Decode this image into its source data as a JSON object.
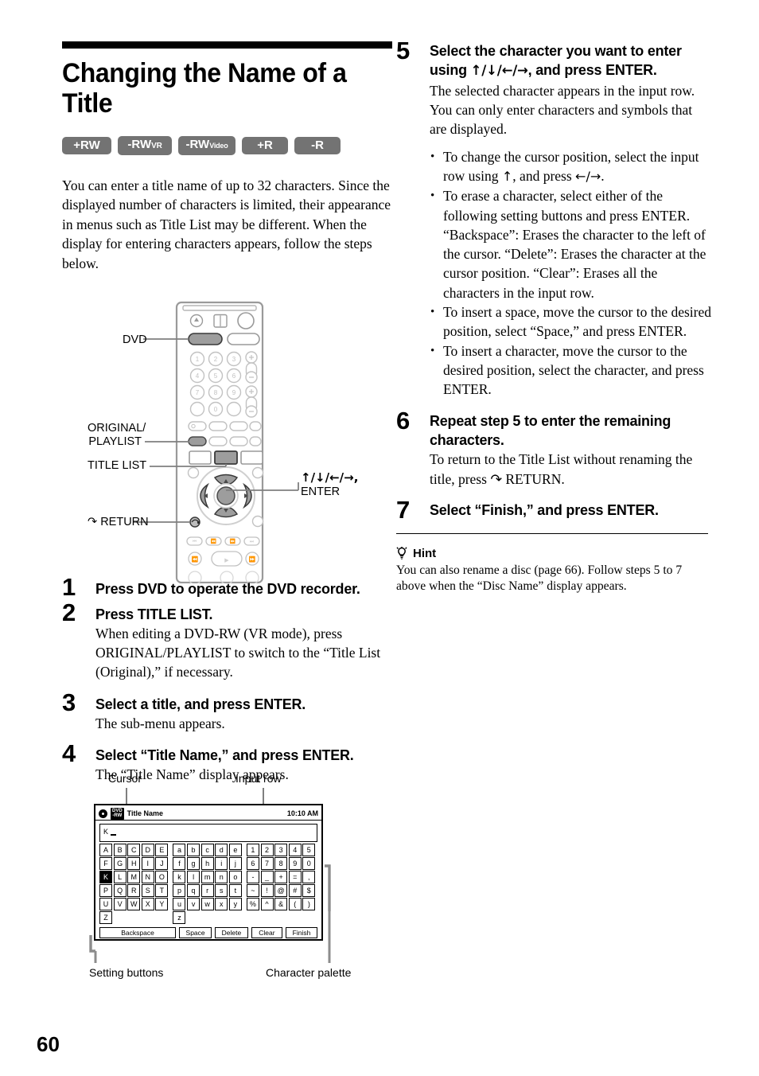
{
  "page": {
    "number": "60"
  },
  "section": {
    "title": "Changing the Name of a Title",
    "badges": [
      {
        "name": "plus-rw",
        "main": "+RW",
        "sub": ""
      },
      {
        "name": "minus-rw-vr",
        "main": "-RW",
        "sub": "VR"
      },
      {
        "name": "minus-rw-video",
        "main": "-RW",
        "sub": "Video"
      },
      {
        "name": "plus-r",
        "main": "+R",
        "sub": ""
      },
      {
        "name": "minus-r",
        "main": "-R",
        "sub": ""
      }
    ],
    "intro": "You can enter a title name of up to 32 characters. Since the displayed number of characters is limited, their appearance in menus such as Title List may be different. When the display for entering characters appears, follow the steps below."
  },
  "remote": {
    "callouts": [
      {
        "name": "dvd",
        "label": "DVD"
      },
      {
        "name": "original-playlist",
        "label": "ORIGINAL/\nPLAYLIST",
        "line1": "ORIGINAL/",
        "line2": "PLAYLIST"
      },
      {
        "name": "title-list",
        "label": "TITLE LIST"
      },
      {
        "name": "return",
        "label": "RETURN"
      },
      {
        "name": "dpad-enter",
        "line1": "↑/↓/←/→,",
        "line2": "ENTER"
      }
    ]
  },
  "steps_left": [
    {
      "num": "1",
      "head": "Press DVD to operate the DVD recorder.",
      "sub": ""
    },
    {
      "num": "2",
      "head": "Press TITLE LIST.",
      "sub": "When editing a DVD-RW (VR mode), press ORIGINAL/PLAYLIST to switch to the “Title List (Original),” if necessary."
    },
    {
      "num": "3",
      "head": "Select a title, and press ENTER.",
      "sub": "The sub-menu appears."
    },
    {
      "num": "4",
      "head": "Select “Title Name,” and press ENTER.",
      "sub": "The “Title Name” display appears."
    }
  ],
  "steps_right": [
    {
      "num": "5",
      "head_line1": "Select the character you want to enter",
      "head_line2_pre": "using ",
      "head_arrows": "↑/↓/←/→",
      "head_line2_post": ", and press ENTER.",
      "sub1": "The selected character appears in the input row.",
      "sub2": "You can only enter characters and symbols that are displayed.",
      "bullets": [
        {
          "name": "bullet-cursor-position",
          "pre": "To change the cursor position, select the input row using ",
          "arrow1": "↑",
          "mid": ", and press ",
          "arrow2": "←/→",
          "post": "."
        },
        {
          "name": "bullet-erase-character",
          "text": "To erase a character, select either of the following setting buttons and press ENTER. “Backspace”: Erases the character to the left of the cursor. “Delete”: Erases the character at the cursor position. “Clear”: Erases all the characters in the input row."
        },
        {
          "name": "bullet-insert-space",
          "text": "To insert a space, move the cursor to the desired position, select “Space,” and press ENTER."
        },
        {
          "name": "bullet-insert-character",
          "text": "To insert a character, move the cursor to the desired position, select the character, and press ENTER."
        }
      ]
    },
    {
      "num": "6",
      "head_line1": "Repeat step 5 to enter the remaining",
      "head_line2": "characters.",
      "sub_pre": "To return to the Title List without renaming the title, press ",
      "sub_post": " RETURN."
    },
    {
      "num": "7",
      "head": "Select “Finish,” and press ENTER.",
      "sub": ""
    }
  ],
  "hint": {
    "label": "Hint",
    "text": "You can also rename a disc (page 66). Follow steps 5 to 7 above when the “Disc Name” display appears."
  },
  "osd": {
    "labels": {
      "cursor": "Cursor",
      "input_row": "Input row",
      "setting_buttons": "Setting buttons",
      "character_palette": "Character palette"
    },
    "header": {
      "disc_badge_line1": "DVD",
      "disc_badge_line2": "-RW",
      "title": "Title Name",
      "time": "10:10 AM"
    },
    "input_value": "K",
    "selected_key": "K",
    "palette_rows": [
      [
        "A",
        "B",
        "C",
        "D",
        "E",
        "a",
        "b",
        "c",
        "d",
        "e",
        "1",
        "2",
        "3",
        "4",
        "5"
      ],
      [
        "F",
        "G",
        "H",
        "I",
        "J",
        "f",
        "g",
        "h",
        "i",
        "j",
        "6",
        "7",
        "8",
        "9",
        "0"
      ],
      [
        "K",
        "L",
        "M",
        "N",
        "O",
        "k",
        "l",
        "m",
        "n",
        "o",
        "-",
        "_",
        "+",
        "=",
        ","
      ],
      [
        "P",
        "Q",
        "R",
        "S",
        "T",
        "p",
        "q",
        "r",
        "s",
        "t",
        "~",
        "!",
        "@",
        "#",
        "$"
      ],
      [
        "U",
        "V",
        "W",
        "X",
        "Y",
        "u",
        "v",
        "w",
        "x",
        "y",
        "%",
        "^",
        "&",
        "(",
        ")"
      ],
      [
        "Z",
        "",
        "",
        "",
        "",
        "z",
        "",
        "",
        "",
        "",
        "",
        "",
        "",
        "",
        ""
      ]
    ],
    "setting_buttons": [
      "Backspace",
      "Space",
      "Delete",
      "Clear",
      "Finish"
    ]
  },
  "colors": {
    "badge_bg": "#737373",
    "rule": "#000000",
    "leader": "#7f7f7f"
  }
}
